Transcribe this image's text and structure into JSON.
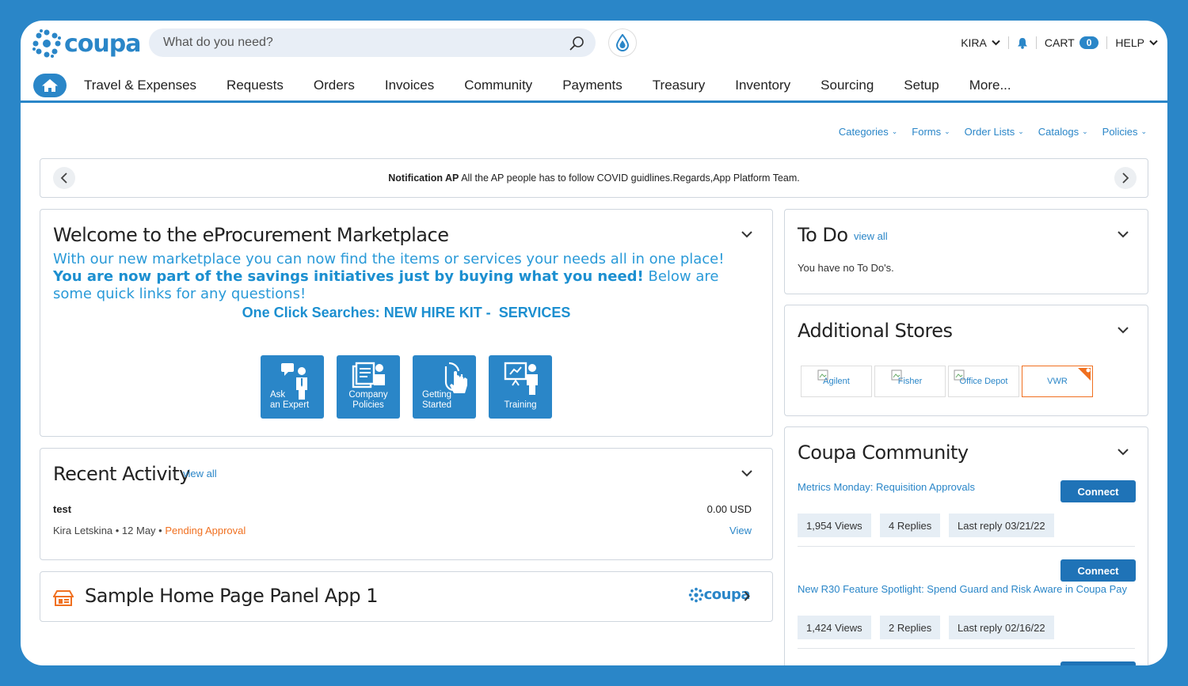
{
  "colors": {
    "accent": "#2a86c8",
    "button": "#1f73b7",
    "orange": "#f07020"
  },
  "brand": {
    "name": "coupa"
  },
  "search": {
    "placeholder": "What do you need?"
  },
  "user": {
    "name": "KIRA"
  },
  "cart": {
    "label": "CART",
    "count": "0"
  },
  "help": {
    "label": "HELP"
  },
  "nav": {
    "items": [
      "Travel & Expenses",
      "Requests",
      "Orders",
      "Invoices",
      "Community",
      "Payments",
      "Treasury",
      "Inventory",
      "Sourcing",
      "Setup",
      "More..."
    ]
  },
  "subnav": {
    "items": [
      "Categories",
      "Forms",
      "Order Lists",
      "Catalogs",
      "Policies"
    ]
  },
  "notification": {
    "title": "Notification AP",
    "text": "All the AP people has to follow COVID guidlines.Regards,App Platform Team."
  },
  "welcome": {
    "title": "Welcome to the eProcurement Marketplace",
    "text_1": "With our new marketplace you can now find the items or services your needs all in one place!",
    "text_bold": "You are now part of the savings initiatives just by buying what you need!",
    "text_2": "Below are some quick links for any questions!",
    "oneclick_label": "One Click Searches:",
    "oneclick_1": "NEW HIRE KIT -",
    "oneclick_2": "SERVICES",
    "tiles": [
      {
        "line1": "Ask",
        "line2": "an Expert",
        "icon": "expert-icon"
      },
      {
        "line1": "Company",
        "line2": "Policies",
        "icon": "policies-icon"
      },
      {
        "line1": "Getting",
        "line2": "Started",
        "icon": "pointer-icon"
      },
      {
        "line1": "Training",
        "line2": "",
        "icon": "training-icon"
      }
    ]
  },
  "recent": {
    "title": "Recent Activity",
    "view_all": "view all",
    "item": {
      "name": "test",
      "amount": "0.00 USD",
      "meta": "Kira Letskina • 12 May •",
      "status": "Pending Approval",
      "action": "View"
    }
  },
  "sample_app": {
    "title": "Sample Home Page Panel App 1",
    "logo": "coupa"
  },
  "todo": {
    "title": "To Do",
    "view_all": "view all",
    "empty": "You have no To Do's."
  },
  "stores": {
    "title": "Additional Stores",
    "items": [
      "Agilent",
      "Fisher",
      "Office Depot",
      "VWR"
    ]
  },
  "community": {
    "title": "Coupa Community",
    "posts": [
      {
        "title": "Metrics Monday: Requisition Approvals",
        "button": "Connect",
        "views": "1,954 Views",
        "replies": "4 Replies",
        "last_reply": "Last reply 03/21/22"
      },
      {
        "title": "New R30 Feature Spotlight: Spend Guard and Risk Aware in Coupa Pay",
        "button": "Connect",
        "views": "1,424 Views",
        "replies": "2 Replies",
        "last_reply": "Last reply 02/16/22"
      }
    ]
  }
}
